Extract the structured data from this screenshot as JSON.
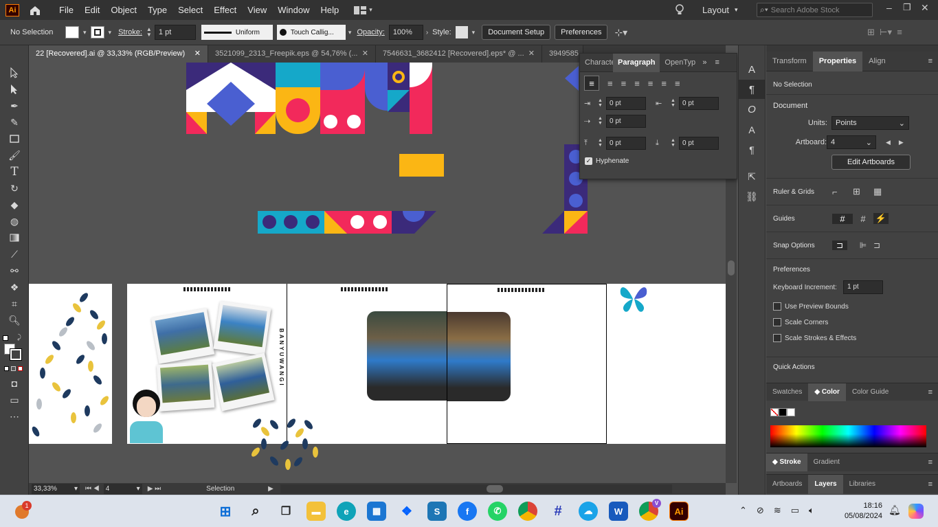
{
  "app": {
    "logo": "Ai"
  },
  "menu": [
    "File",
    "Edit",
    "Object",
    "Type",
    "Select",
    "Effect",
    "View",
    "Window",
    "Help"
  ],
  "workspace": "Layout",
  "search": {
    "placeholder": "Search Adobe Stock"
  },
  "control": {
    "selection": "No Selection",
    "stroke_label": "Stroke:",
    "stroke_value": "1 pt",
    "uniform": "Uniform",
    "brush": "Touch Callig...",
    "opacity_label": "Opacity:",
    "opacity_value": "100%",
    "style_label": "Style:",
    "doc_setup": "Document Setup",
    "preferences": "Preferences"
  },
  "tabs": [
    {
      "label": "22 [Recovered].ai @ 33,33% (RGB/Preview)"
    },
    {
      "label": "3521099_2313_Freepik.eps @ 54,76% (..."
    },
    {
      "label": "7546631_3682412 [Recovered].eps* @ ..."
    },
    {
      "label": "3949585"
    }
  ],
  "paragraph_panel": {
    "tabs": [
      "Characte",
      "Paragraph",
      "OpenTyp"
    ],
    "fields": [
      "0 pt",
      "0 pt",
      "0 pt",
      "0 pt",
      "0 pt"
    ],
    "hyphenate": "Hyphenate"
  },
  "status": {
    "zoom": "33,33%",
    "artboard": "4",
    "mode": "Selection"
  },
  "right_panel": {
    "tabs": [
      "Transform",
      "Properties",
      "Align"
    ],
    "no_selection": "No Selection",
    "document": "Document",
    "units_label": "Units:",
    "units_value": "Points",
    "artboard_label": "Artboard:",
    "artboard_value": "4",
    "edit_artboards": "Edit Artboards",
    "rulers": "Ruler & Grids",
    "guides": "Guides",
    "snap": "Snap Options",
    "preferences": "Preferences",
    "kb_label": "Keyboard Increment:",
    "kb_value": "1 pt",
    "preview_bounds": "Use Preview Bounds",
    "scale_corners": "Scale Corners",
    "scale_strokes": "Scale Strokes & Effects",
    "quick_actions": "Quick Actions",
    "color_tabs": [
      "Swatches",
      "Color",
      "Color Guide"
    ],
    "stroke_tabs": [
      "Stroke",
      "Gradient"
    ],
    "bottom_tabs": [
      "Artboards",
      "Layers",
      "Libraries"
    ]
  },
  "canvas_text": {
    "vertical": "BANYUWANGI"
  },
  "taskbar": {
    "time": "18:16",
    "date": "05/08/2024",
    "notif": "1",
    "avatar": "V"
  },
  "colors": {
    "navy": "#3b2a7a",
    "pink": "#f2295b",
    "yellow": "#fbb614",
    "teal": "#15a8c9",
    "blue": "#4a5fd1"
  }
}
